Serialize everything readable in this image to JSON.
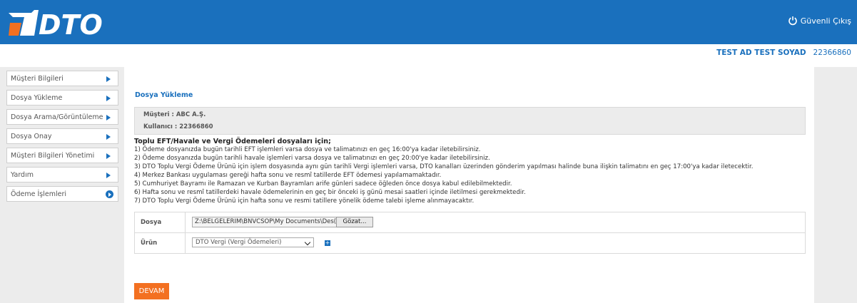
{
  "header": {
    "logo_text": "DTO",
    "logout_label": "Güvenli Çıkış",
    "colors": {
      "brand": "#1a70bd",
      "logo_accent": "#f37021"
    }
  },
  "user": {
    "name": "TEST AD TEST SOYAD",
    "id": "22366860"
  },
  "sidebar": {
    "items": [
      {
        "label": "Müşteri Bilgileri",
        "icon": "arrow-right-icon"
      },
      {
        "label": "Dosya Yükleme",
        "icon": "arrow-right-icon"
      },
      {
        "label": "Dosya Arama/Görüntüleme",
        "icon": "arrow-right-icon"
      },
      {
        "label": "Dosya Onay",
        "icon": "arrow-right-icon"
      },
      {
        "label": "Müşteri Bilgileri Yönetimi",
        "icon": "arrow-right-icon"
      },
      {
        "label": "Yardım",
        "icon": "arrow-right-icon"
      },
      {
        "label": "Ödeme İşlemleri",
        "icon": "circle-arrow-icon"
      }
    ]
  },
  "main": {
    "title": "Dosya Yükleme",
    "info": {
      "customer": "Müşteri :  ABC A.Ş.",
      "user": "Kullanıcı : 22366860"
    },
    "notes_title": "Toplu EFT/Havale ve Vergi Ödemeleri dosyaları için;",
    "notes": [
      "1) Ödeme dosyanızda bugün tarihli EFT işlemleri varsa dosya ve talimatınızı en geç 16:00'ya kadar iletebilirsiniz.",
      "2) Ödeme dosyanızda bugün tarihli havale işlemleri varsa dosya ve talimatınızı en geç 20:00'ye kadar iletebilirsiniz.",
      "3) DTO Toplu Vergi Ödeme Ürünü için işlem dosyasında aynı gün tarihli Vergi işlemleri varsa, DTO kanalları üzerinden gönderim yapılması halinde buna ilişkin talimatını en geç 17:00'ya kadar iletecektir.",
      "4) Merkez Bankası uygulaması gereği hafta sonu ve resmî tatillerde EFT ödemesi yapılamamaktadır.",
      "5) Cumhuriyet Bayramı ile Ramazan ve Kurban Bayramları arife günleri sadece öğleden önce dosya kabul edilebilmektedir.",
      "6) Hafta sonu ve resmî tatillerdeki havale ödemelerinin en geç bir önceki iş günü mesai saatleri içinde iletilmesi gerekmektedir.",
      "7) DTO Toplu Vergi Ödeme Ürünü için hafta sonu ve resmi tatillere yönelik ödeme talebi işleme alınmayacaktır."
    ],
    "form": {
      "file_label": "Dosya",
      "file_value": "Z:\\BELGELERIM\\BNVCSOP\\My Documents\\Des(",
      "browse_label": "Gözat...",
      "product_label": "Ürün",
      "product_value": "DTO Vergi (Vergi Ödemeleri)"
    },
    "submit_label": "DEVAM",
    "submit_color": "#f37021"
  }
}
